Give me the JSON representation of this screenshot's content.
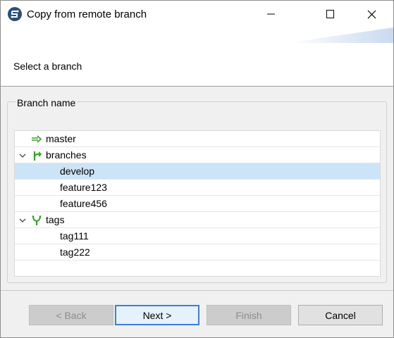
{
  "window": {
    "title": "Copy from remote branch",
    "icon": "talend-app-icon"
  },
  "header": {
    "text": "Select a branch"
  },
  "group": {
    "label": "Branch name"
  },
  "tree": {
    "rows": [
      {
        "label": "master",
        "icon": "arrow-right-icon",
        "level": 0,
        "expandable": false,
        "selected": false
      },
      {
        "label": "branches",
        "icon": "branch-icon",
        "level": 0,
        "expandable": true,
        "expanded": true,
        "selected": false
      },
      {
        "label": "develop",
        "icon": "",
        "level": 1,
        "expandable": false,
        "selected": true
      },
      {
        "label": "feature123",
        "icon": "",
        "level": 1,
        "expandable": false,
        "selected": false
      },
      {
        "label": "feature456",
        "icon": "",
        "level": 1,
        "expandable": false,
        "selected": false
      },
      {
        "label": "tags",
        "icon": "tag-fork-icon",
        "level": 0,
        "expandable": true,
        "expanded": true,
        "selected": false
      },
      {
        "label": "tag111",
        "icon": "",
        "level": 1,
        "expandable": false,
        "selected": false
      },
      {
        "label": "tag222",
        "icon": "",
        "level": 1,
        "expandable": false,
        "selected": false
      }
    ]
  },
  "buttons": {
    "back": "< Back",
    "next": "Next >",
    "finish": "Finish",
    "cancel": "Cancel"
  },
  "colors": {
    "selection": "#cce4f7",
    "accent": "#3c7fd6",
    "icon_green": "#3a9d2e"
  }
}
